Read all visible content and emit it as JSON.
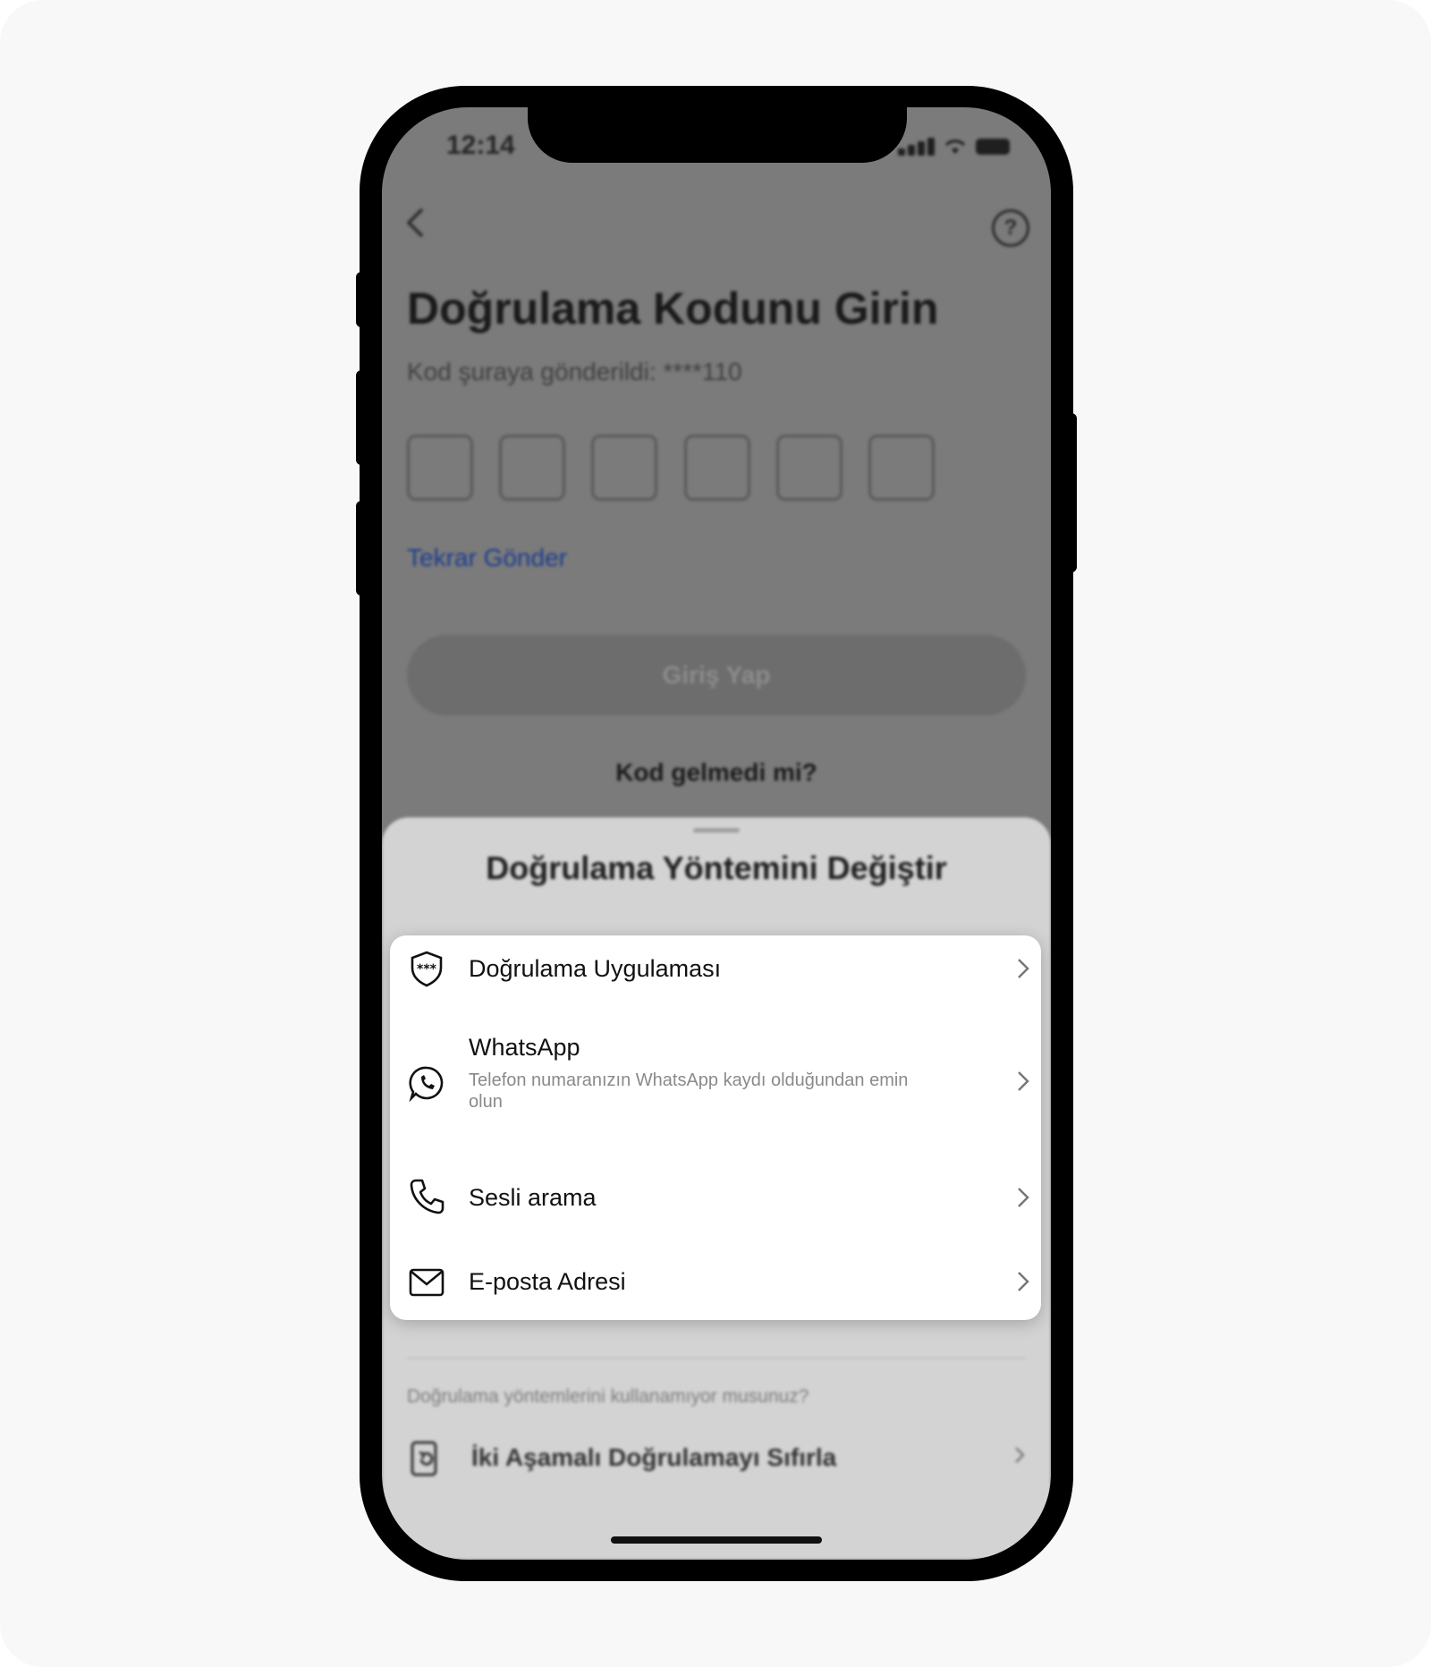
{
  "status": {
    "time": "12:14"
  },
  "background_page": {
    "title": "Doğrulama Kodunu Girin",
    "subtitle": "Kod şuraya gönderildi: ****110",
    "resend": "Tekrar Gönder",
    "login_button": "Giriş Yap",
    "no_code": "Kod gelmedi mi?",
    "help_icon": "?"
  },
  "sheet": {
    "title": "Doğrulama Yöntemini Değiştir",
    "hint": "Doğrulama yöntemlerini kullanamıyor musunuz?",
    "reset_label": "İki Aşamalı Doğrulamayı Sıfırla"
  },
  "methods": [
    {
      "label": "Doğrulama Uygulaması",
      "icon": "shield-password-icon"
    },
    {
      "label": "WhatsApp",
      "description": "Telefon numaranızın WhatsApp kaydı olduğundan emin olun",
      "icon": "whatsapp-icon"
    },
    {
      "label": "Sesli arama",
      "icon": "phone-icon"
    },
    {
      "label": "E-posta Adresi",
      "icon": "mail-icon"
    }
  ]
}
